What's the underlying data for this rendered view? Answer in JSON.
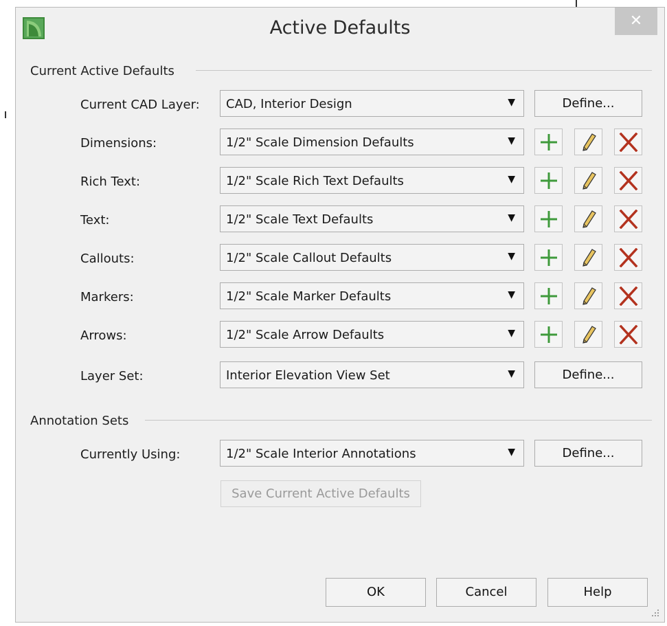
{
  "window": {
    "title": "Active Defaults",
    "close_glyph": "✕"
  },
  "current_active_defaults": {
    "title": "Current Active Defaults",
    "cad_layer": {
      "label": "Current CAD Layer:",
      "value": "CAD, Interior Design",
      "button": "Define..."
    },
    "rows": [
      {
        "label": "Dimensions:",
        "value": "1/2\" Scale Dimension Defaults"
      },
      {
        "label": "Rich Text:",
        "value": "1/2\" Scale Rich Text Defaults"
      },
      {
        "label": "Text:",
        "value": "1/2\" Scale Text Defaults"
      },
      {
        "label": "Callouts:",
        "value": "1/2\" Scale Callout Defaults"
      },
      {
        "label": "Markers:",
        "value": "1/2\" Scale Marker Defaults"
      },
      {
        "label": "Arrows:",
        "value": "1/2\" Scale Arrow Defaults"
      }
    ],
    "layer_set": {
      "label": "Layer Set:",
      "value": "Interior Elevation View Set",
      "button": "Define..."
    }
  },
  "annotation_sets": {
    "title": "Annotation Sets",
    "currently_using": {
      "label": "Currently Using:",
      "value": "1/2\" Scale Interior Annotations",
      "button": "Define..."
    },
    "save_button": "Save Current Active Defaults"
  },
  "footer": {
    "ok": "OK",
    "cancel": "Cancel",
    "help": "Help"
  },
  "icons": {
    "add": "plus-icon",
    "edit": "pencil-icon",
    "delete": "x-icon",
    "colors": {
      "add": "#3f9a3c",
      "delete": "#b3321e",
      "app_icon": "#3d8a3a"
    }
  }
}
